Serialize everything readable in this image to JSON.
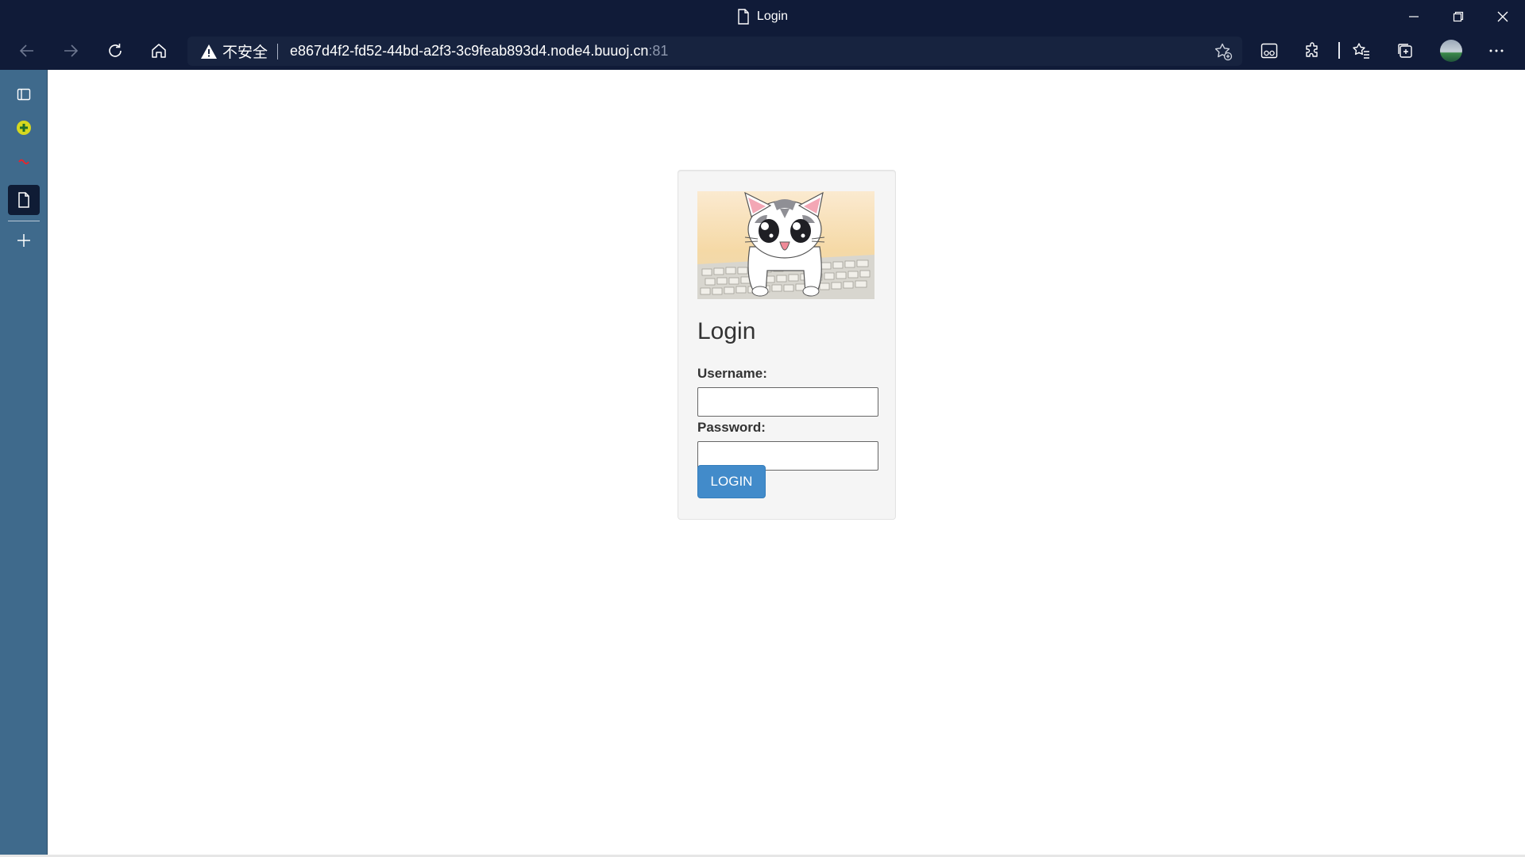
{
  "window": {
    "title": "Login"
  },
  "toolbar": {
    "security_label": "不安全",
    "url": "e867d4f2-fd52-44bd-a2f3-3c9feab893d4.node4.buuoj.cn",
    "port": ":81"
  },
  "sidebar": {
    "items": [
      {
        "icon": "tab-actions-icon"
      },
      {
        "icon": "extension-favicon-icon"
      },
      {
        "icon": "tab-favicon-icon"
      },
      {
        "icon": "page-tab-icon",
        "active": true
      },
      {
        "icon": "new-tab-plus-icon"
      }
    ]
  },
  "login": {
    "image_alt": "cat at keyboard",
    "heading": "Login",
    "username_label": "Username:",
    "username_value": "",
    "password_label": "Password:",
    "password_value": "",
    "button_label": "LOGIN"
  },
  "colors": {
    "chrome": "#101b38",
    "sidebar": "#3f6a8c",
    "card_bg": "#f5f5f5",
    "button": "#428bca"
  }
}
